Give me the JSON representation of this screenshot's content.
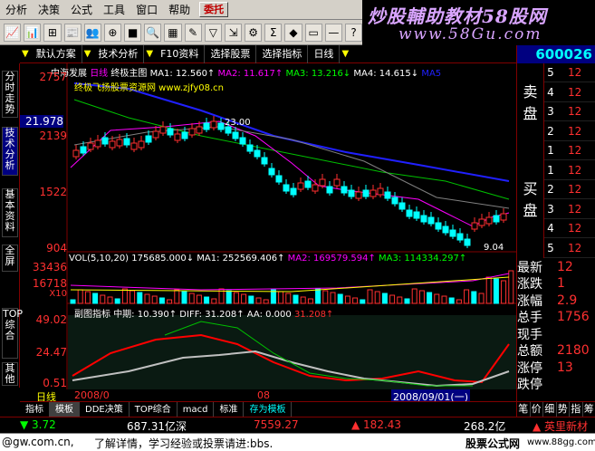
{
  "menubar": {
    "items": [
      "分析",
      "决策",
      "公式",
      "工具",
      "窗口",
      "帮助"
    ],
    "trade_label": "委托"
  },
  "brand": {
    "title": "炒股輔助教材58股网",
    "url": "www.58Gu.com"
  },
  "toolbar": {
    "icons": [
      "quote-icon",
      "chart-icon",
      "kline-icon",
      "news-icon",
      "group-icon",
      "compass-icon",
      "stock-icon",
      "zoom-icon",
      "layout-icon",
      "note-icon",
      "filter-icon",
      "export-icon",
      "settings-icon",
      "calc-icon",
      "diamond-icon",
      "window-icon",
      "minimize-icon",
      "help-icon"
    ]
  },
  "header": {
    "default_scheme": "默认方案",
    "tech_analysis": "技术分析",
    "f10": "F10资料",
    "select_stock": "选择股票",
    "select_indicator": "选择指标",
    "period": "日线"
  },
  "left_tabs": [
    "分时走势",
    "技术分析",
    "基本资料",
    "全屏",
    "TOP综合",
    "其他"
  ],
  "main_chart": {
    "stock_name": "中海发展",
    "period": "日线",
    "template": "终极主图",
    "ma1": "MA1: 12.560↑",
    "ma2": "MA2: 11.617↑",
    "ma3": "MA3: 13.216↓",
    "ma4": "MA4: 14.615↓",
    "ma5": "MA5",
    "watermark": "终极飞扬股票资源网 www.zjfy08.cn",
    "price_labels": [
      "2757",
      "21.978",
      "2139",
      "1522",
      "904"
    ],
    "high_mark": "23.00",
    "low_mark": "9.04"
  },
  "volume_chart": {
    "legend": "VOL(5,10,20) 175685.000↓",
    "ma1": "MA1: 252569.406↑",
    "ma2": "MA2: 169579.594↑",
    "ma3": "MA3: 114334.297↑",
    "labels": [
      "33436",
      "16718",
      "X10"
    ]
  },
  "sub_chart": {
    "name": "副图指标",
    "mid": "中期: 10.390↑",
    "diff": "DIFF: 31.208↑",
    "aa": "AA: 0.000",
    "last": "31.208↑",
    "labels": [
      "49.02",
      "24.47",
      "0.51"
    ]
  },
  "date_bar": {
    "period": "日线",
    "start_date": "2008/0",
    "mid": "08",
    "current_date": "2008/09/01(一)"
  },
  "bottom_tabs": [
    "指标",
    "模板",
    "DDE决策",
    "TOP综合",
    "macd",
    "标准",
    "存为模板"
  ],
  "right_panel": {
    "code": "600026",
    "sell_label": "卖盘",
    "buy_label": "买盘",
    "sell_rows": [
      {
        "n": "5",
        "v": "12"
      },
      {
        "n": "4",
        "v": "12"
      },
      {
        "n": "3",
        "v": "12"
      },
      {
        "n": "2",
        "v": "12"
      },
      {
        "n": "1",
        "v": "12"
      }
    ],
    "buy_rows": [
      {
        "n": "1",
        "v": "12"
      },
      {
        "n": "2",
        "v": "12"
      },
      {
        "n": "3",
        "v": "12"
      },
      {
        "n": "4",
        "v": "12"
      },
      {
        "n": "5",
        "v": "12"
      }
    ],
    "stats": [
      {
        "label": "最新",
        "value": "12"
      },
      {
        "label": "涨跌",
        "value": "1"
      },
      {
        "label": "涨幅",
        "value": "2.9"
      },
      {
        "label": "总手",
        "value": "1756"
      },
      {
        "label": "现手",
        "value": ""
      },
      {
        "label": "总额",
        "value": "2180"
      },
      {
        "label": "涨停",
        "value": "13"
      },
      {
        "label": "跌停",
        "value": ""
      }
    ],
    "bottom_tabs": [
      "笔",
      "价",
      "细",
      "势",
      "指",
      "筹"
    ]
  },
  "ticker": {
    "change1": "▼ 3.72",
    "index1": "687.31亿深",
    "index2": "7559.27",
    "change2": "▲ 182.43",
    "index3": "268.2亿",
    "news": "▲ 英里新材"
  },
  "statusbar": {
    "email": "@gw.com.cn,",
    "message": "了解详情，学习经验或投票请进:bbs.",
    "brand": "股票公式网",
    "brand_url": "www.88gg.com"
  },
  "colors": {
    "up": "#ff3030",
    "down": "#00ffff",
    "ma_blue": "#2020ff",
    "ma_green": "#00c000",
    "ma_magenta": "#ff00ff",
    "sub_red": "#ff0000",
    "sub_white": "#c0c0c0"
  }
}
